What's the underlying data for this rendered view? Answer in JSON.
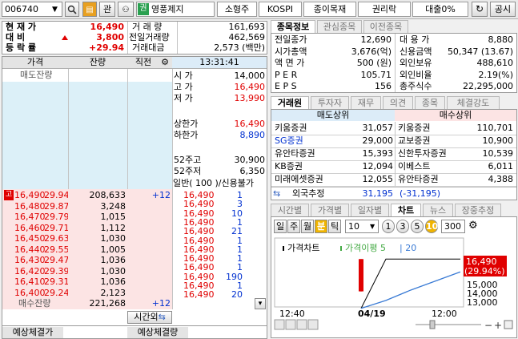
{
  "toolbar": {
    "code": "006740",
    "btn_gwan": "관",
    "stock_badge": "권",
    "stock_name": "영풍제지",
    "market_cap_tag": "소형주",
    "market_tag": "KOSPI",
    "sector_tag": "종이목재",
    "rights_tag": "권리락",
    "loan_tag": "대출0%",
    "notice_btn": "공시"
  },
  "summary": {
    "labels": {
      "current": "현 재 가",
      "change": "대 비",
      "rate": "등 락 률"
    },
    "current": "16,490",
    "change": "3,800",
    "rate": "+29.94",
    "vol_label": "거 래 량",
    "vol": "161,693",
    "prev_vol_label": "전일거래량",
    "prev_vol": "462,569",
    "amount_label": "거래대금",
    "amount": "2,573 (백만)"
  },
  "info_tabs": [
    "종목정보",
    "관심종목",
    "이전종목"
  ],
  "info": {
    "left": [
      {
        "label": "전일종가",
        "value": "12,690"
      },
      {
        "label": "시가총액",
        "value": "3,676(억)"
      },
      {
        "label": "액 면 가",
        "value": "500 (원)"
      },
      {
        "label": "P E R",
        "value": "105.71"
      },
      {
        "label": "E P S",
        "value": "156"
      }
    ],
    "right": [
      {
        "label": "대 용 가",
        "value": "8,880"
      },
      {
        "label": "신용금액",
        "value": "50,347 (13.67)"
      },
      {
        "label": "외인보유",
        "value": "488,610"
      },
      {
        "label": "외인비율",
        "value": "2.19(%)"
      },
      {
        "label": "총주식수",
        "value": "22,295,000"
      }
    ]
  },
  "orderbook": {
    "headers": {
      "price": "가격",
      "qty": "잔량",
      "prev": "직전",
      "time": "13:31:41"
    },
    "sell_total_label": "매도잔량",
    "stats": [
      {
        "label": "시 가",
        "value": "14,000"
      },
      {
        "label": "고 가",
        "value": "16,490"
      },
      {
        "label": "저 가",
        "value": "13,990"
      },
      {
        "label": "상한가",
        "value": "16,490"
      },
      {
        "label": "하한가",
        "value": "8,890"
      },
      {
        "label": "52주고",
        "value": "30,900"
      },
      {
        "label": "52주저",
        "value": "6,350"
      }
    ],
    "credit_label": "일반( 100 )/신용불가",
    "high_badge": "고",
    "bids": [
      {
        "price": "16,490",
        "rate": "29.94",
        "qty": "208,633",
        "chg": "+12"
      },
      {
        "price": "16,480",
        "rate": "29.87",
        "qty": "3,248",
        "chg": ""
      },
      {
        "price": "16,470",
        "rate": "29.79",
        "qty": "1,015",
        "chg": ""
      },
      {
        "price": "16,460",
        "rate": "29.71",
        "qty": "1,112",
        "chg": ""
      },
      {
        "price": "16,450",
        "rate": "29.63",
        "qty": "1,030",
        "chg": ""
      },
      {
        "price": "16,440",
        "rate": "29.55",
        "qty": "1,005",
        "chg": ""
      },
      {
        "price": "16,430",
        "rate": "29.47",
        "qty": "1,036",
        "chg": ""
      },
      {
        "price": "16,420",
        "rate": "29.39",
        "qty": "1,030",
        "chg": ""
      },
      {
        "price": "16,410",
        "rate": "29.31",
        "qty": "1,036",
        "chg": ""
      },
      {
        "price": "16,400",
        "rate": "29.24",
        "qty": "2,123",
        "chg": ""
      }
    ],
    "buy_total_label": "매수잔량",
    "buy_total": "221,268",
    "buy_total_chg": "+12",
    "time_btn": "시간외",
    "expect_price_label": "예상체결가",
    "expect_vol_label": "예상체결량"
  },
  "ticks": [
    {
      "price": "16,490",
      "qty": "1"
    },
    {
      "price": "16,490",
      "qty": "3"
    },
    {
      "price": "16,490",
      "qty": "10"
    },
    {
      "price": "16,490",
      "qty": "1"
    },
    {
      "price": "16,490",
      "qty": "21"
    },
    {
      "price": "16,490",
      "qty": "1"
    },
    {
      "price": "16,490",
      "qty": "1"
    },
    {
      "price": "16,490",
      "qty": "1"
    },
    {
      "price": "16,490",
      "qty": "1"
    },
    {
      "price": "16,490",
      "qty": "190"
    },
    {
      "price": "16,490",
      "qty": "1"
    },
    {
      "price": "16,490",
      "qty": "20"
    }
  ],
  "broker_tabs": [
    "거래원",
    "투자자",
    "재무",
    "의견",
    "종목",
    "체결강도"
  ],
  "broker": {
    "sell_header": "매도상위",
    "buy_header": "매수상위",
    "rows": [
      {
        "sell_name": "키움증권",
        "sell_qty": "31,057",
        "buy_name": "키움증권",
        "buy_qty": "110,701"
      },
      {
        "sell_name": "SG증권",
        "sell_qty": "29,000",
        "buy_name": "교보증권",
        "buy_qty": "10,900"
      },
      {
        "sell_name": "유안타증권",
        "sell_qty": "15,393",
        "buy_name": "신한투자증권",
        "buy_qty": "10,539"
      },
      {
        "sell_name": "KB증권",
        "sell_qty": "12,094",
        "buy_name": "이베스트",
        "buy_qty": "6,011"
      },
      {
        "sell_name": "미래에셋증권",
        "sell_qty": "12,055",
        "buy_name": "유안타증권",
        "buy_qty": "4,388"
      }
    ],
    "foreign_label": "외국추정",
    "foreign_sell": "31,195",
    "foreign_buy": "(-31,195)"
  },
  "chart_tabs": [
    "시간별",
    "가격별",
    "일자별",
    "차트",
    "뉴스",
    "장중추정"
  ],
  "chart_ctrl": {
    "periods": [
      "일",
      "주",
      "월",
      "분",
      "틱"
    ],
    "interval": "10",
    "steps": [
      "1",
      "3",
      "5",
      "10"
    ],
    "count": "300"
  },
  "chart_data": {
    "type": "line",
    "legend": [
      "가격차트",
      "가격이평 5",
      "20"
    ],
    "x_labels": [
      "12:40",
      "04/19",
      "12:00"
    ],
    "y_labels": [
      "15,000",
      "14,000",
      "13,000"
    ],
    "last_price": "16,490",
    "last_rate": "(29.94%)",
    "ylim": [
      12800,
      17000
    ],
    "candle": {
      "open": 14000,
      "high": 16490,
      "low": 13990,
      "close": 16490
    },
    "price_line": [
      12690,
      16490,
      16490,
      16490,
      16490
    ],
    "ma5": [
      12690,
      13300,
      14100,
      14800,
      15500
    ],
    "colors": {
      "candle": "#e00000",
      "price": "#000000",
      "ma5": "#44aa44",
      "ma20": "#3a7bd5"
    }
  }
}
